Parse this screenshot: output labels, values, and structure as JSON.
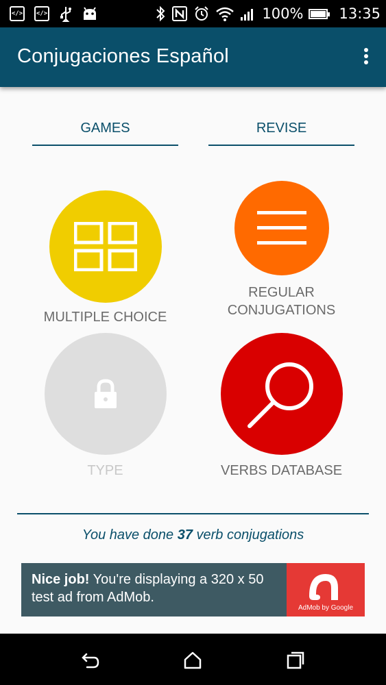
{
  "status_bar": {
    "left_icons": [
      "code-icon",
      "code-icon",
      "usb-icon",
      "android-icon"
    ],
    "code_glyph": "</>",
    "right_icons": [
      "bluetooth-icon",
      "nfc-icon",
      "alarm-icon",
      "wifi-icon",
      "signal-icon"
    ],
    "battery_text": "100%",
    "time": "13:35"
  },
  "toolbar": {
    "title": "Conjugaciones Español",
    "menu_icon": "overflow-menu-icon"
  },
  "tabs": [
    {
      "label": "GAMES"
    },
    {
      "label": "REVISE"
    }
  ],
  "tiles": [
    {
      "label": "MULTIPLE CHOICE",
      "icon": "grid-icon",
      "color": "#f0cd00"
    },
    {
      "label": "REGULAR\nCONJUGATIONS",
      "icon": "lines-icon",
      "color": "#ff6a00"
    },
    {
      "label": "TYPE",
      "icon": "lock-icon",
      "color": "#dedede",
      "disabled": true
    },
    {
      "label": "VERBS DATABASE",
      "icon": "search-icon",
      "color": "#d90000"
    }
  ],
  "progress": {
    "before": "You have done ",
    "count": "37",
    "after": " verb conjugations"
  },
  "ad": {
    "bold": "Nice job!",
    "text": " You're displaying a 320 x 50 test ad from AdMob.",
    "logo_caption": "AdMob by Google"
  },
  "nav_bar": {
    "buttons": [
      "back-icon",
      "home-icon",
      "recents-icon"
    ]
  },
  "colors": {
    "primary": "#0a4f6a",
    "yellow": "#f0cd00",
    "orange": "#ff6a00",
    "red": "#d90000",
    "disabled": "#dedede",
    "ad_bg": "#3e5a63",
    "ad_logo": "#e53935"
  }
}
